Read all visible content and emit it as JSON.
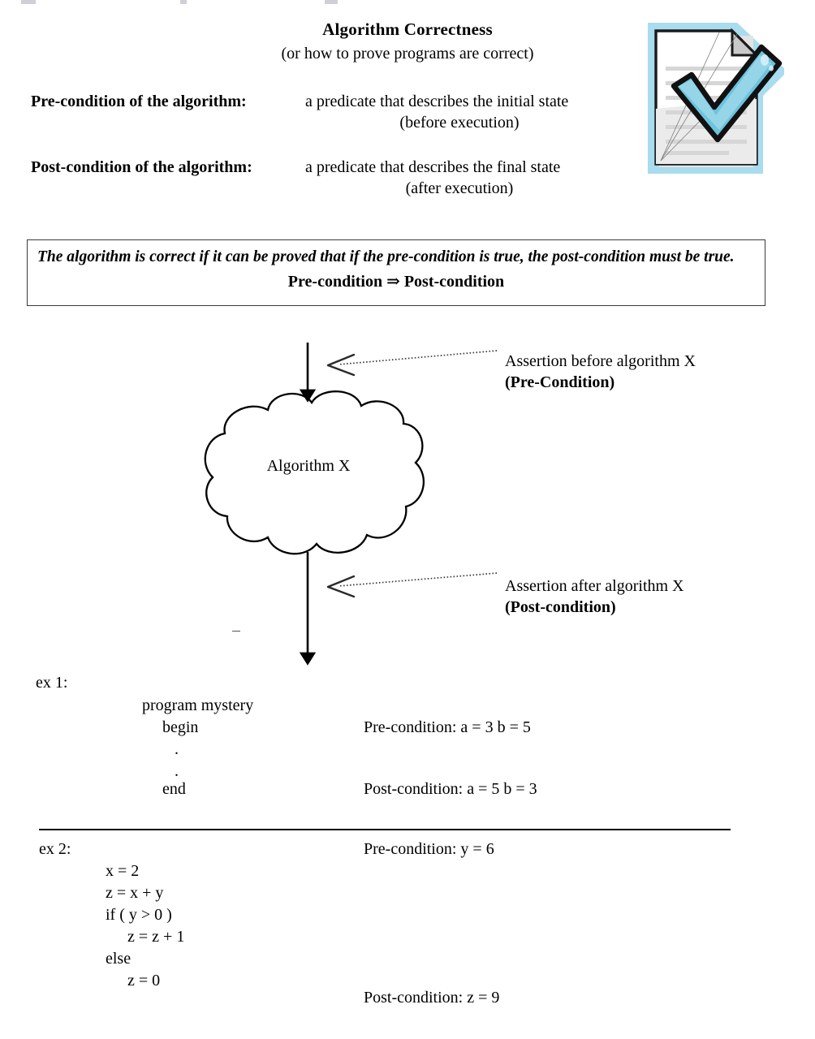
{
  "slide": {
    "title": "Algorithm Correctness",
    "subtitle": "(or how to prove programs are correct)"
  },
  "definitions": {
    "pre": {
      "term": "Pre-condition of the algorithm:",
      "desc_line1": "a predicate that describes the initial state",
      "desc_line2": "(before execution)"
    },
    "post": {
      "term": "Post-condition of the algorithm:",
      "desc_line1": "a predicate that describes the final state",
      "desc_line2": "(after execution)"
    }
  },
  "icon": {
    "name": "document-check-icon",
    "glow_color": "#a9dcee",
    "check_color": "#6ec3de",
    "check_highlight": "#9ed8ea",
    "paper_color": "#ffffff",
    "paper_shadow": "#e2e2e2",
    "fold_color": "#c9c9c9",
    "outline_color": "#1a1a1a",
    "line_color": "#d5d5d5"
  },
  "correctness_box": {
    "statement": "The algorithm is correct if it can be proved that if the pre-condition is true, the post-condition must be true.",
    "implication": "Pre-condition ⇒ Post-condition",
    "border_color": "#3b3b3b"
  },
  "diagram": {
    "cloud_label": "Algorithm X",
    "stroke_color": "#000000",
    "annotations": {
      "pre": {
        "line1": "Assertion before algorithm X",
        "line2": "(Pre-Condition)"
      },
      "post": {
        "line1": "Assertion after algorithm X",
        "line2": "(Post-condition)"
      }
    }
  },
  "examples": {
    "ex1": {
      "label": "ex 1:",
      "code": [
        "program mystery",
        "begin",
        ".",
        ".",
        "end"
      ],
      "precondition": "Pre-condition: a = 3    b = 5",
      "postcondition": "Post-condition: a = 5   b = 3"
    },
    "ex2": {
      "label": "ex 2:",
      "code": [
        "x = 2",
        "z = x + y",
        "if ( y > 0 )",
        "z = z + 1",
        "else",
        "z = 0"
      ],
      "precondition": "Pre-condition:   y = 6",
      "postcondition": "Post-condition: z = 9"
    }
  }
}
